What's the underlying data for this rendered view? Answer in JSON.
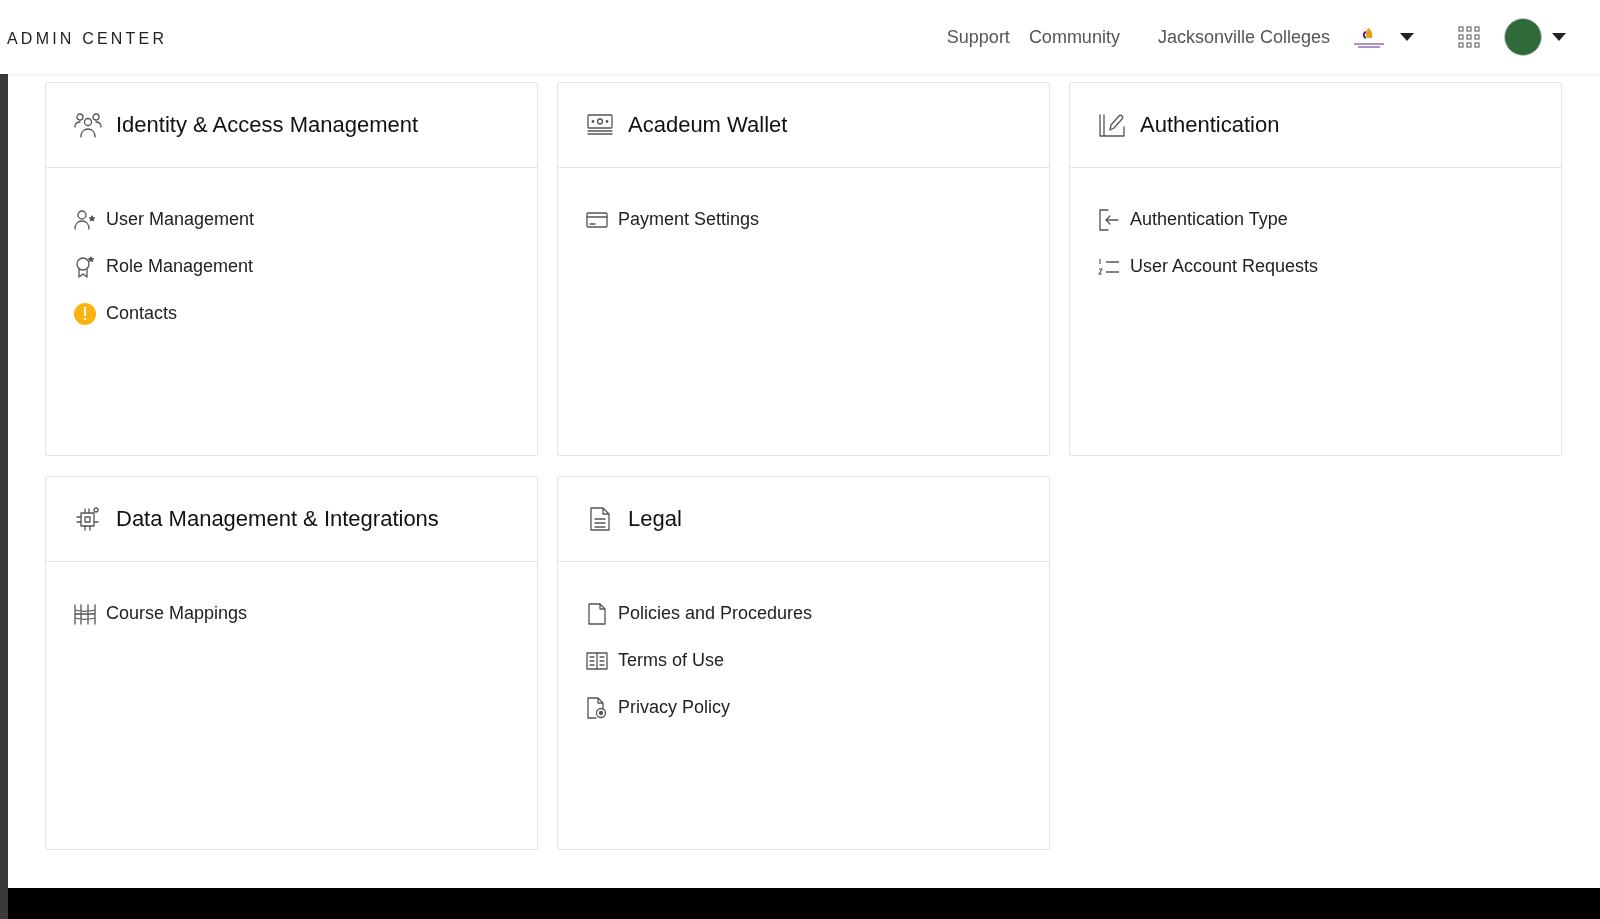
{
  "header": {
    "title": "ADMIN CENTER",
    "links": [
      "Support",
      "Community"
    ],
    "organization": "Jacksonville Colleges"
  },
  "cards": [
    {
      "title": "Identity & Access Management",
      "items": [
        {
          "label": "User Management",
          "alert": false
        },
        {
          "label": "Role Management",
          "alert": false
        },
        {
          "label": "Contacts",
          "alert": true
        }
      ]
    },
    {
      "title": "Acadeum Wallet",
      "items": [
        {
          "label": "Payment Settings",
          "alert": false
        }
      ]
    },
    {
      "title": "Authentication",
      "items": [
        {
          "label": "Authentication Type",
          "alert": false
        },
        {
          "label": "User Account Requests",
          "alert": false
        }
      ]
    },
    {
      "title": "Data Management & Integrations",
      "items": [
        {
          "label": "Course Mappings",
          "alert": false
        }
      ]
    },
    {
      "title": "Legal",
      "items": [
        {
          "label": "Policies and Procedures",
          "alert": false
        },
        {
          "label": "Terms of Use",
          "alert": false
        },
        {
          "label": "Privacy Policy",
          "alert": false
        }
      ]
    }
  ]
}
